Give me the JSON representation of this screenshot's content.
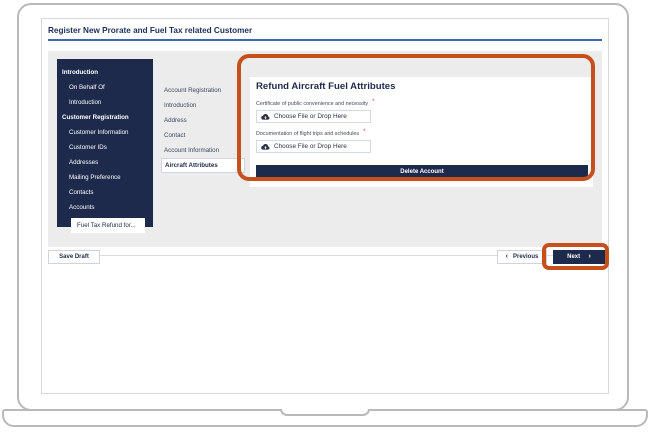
{
  "page": {
    "title": "Register New Prorate and Fuel Tax related Customer"
  },
  "sidebar": {
    "items": [
      {
        "label": "Introduction",
        "type": "head"
      },
      {
        "label": "On Behalf Of",
        "type": "item"
      },
      {
        "label": "Introduction",
        "type": "item"
      },
      {
        "label": "Customer Registration",
        "type": "head"
      },
      {
        "label": "Customer Information",
        "type": "item"
      },
      {
        "label": "Customer IDs",
        "type": "item"
      },
      {
        "label": "Addresses",
        "type": "item"
      },
      {
        "label": "Mailing Preference",
        "type": "item"
      },
      {
        "label": "Contacts",
        "type": "item"
      },
      {
        "label": "Accounts",
        "type": "item"
      },
      {
        "label": "Fuel Tax Refund for...",
        "type": "active"
      }
    ]
  },
  "steps": {
    "items": [
      {
        "label": "Account Registration"
      },
      {
        "label": "Introduction"
      },
      {
        "label": "Address"
      },
      {
        "label": "Contact"
      },
      {
        "label": "Account Information"
      },
      {
        "label": "Aircraft Attributes",
        "current": true
      }
    ]
  },
  "card": {
    "title": "Refund Aircraft Fuel Attributes",
    "field1_label": "Certificate of public convenience and necessity",
    "field2_label": "Documentation of flight trips and schedules",
    "required_marker": "*",
    "upload_text": "Choose File or Drop Here",
    "delete_label": "Delete Account",
    "upload_icon": "cloud-upload-icon"
  },
  "footer": {
    "save_label": "Save Draft",
    "previous_label": "Previous",
    "next_label": "Next",
    "prev_icon": "chevron-left-icon",
    "next_icon": "chevron-right-icon"
  },
  "colors": {
    "navy": "#1d2a4c",
    "highlight": "#c6501c",
    "accent_rule": "#3a67b0",
    "required": "#d0342c"
  }
}
